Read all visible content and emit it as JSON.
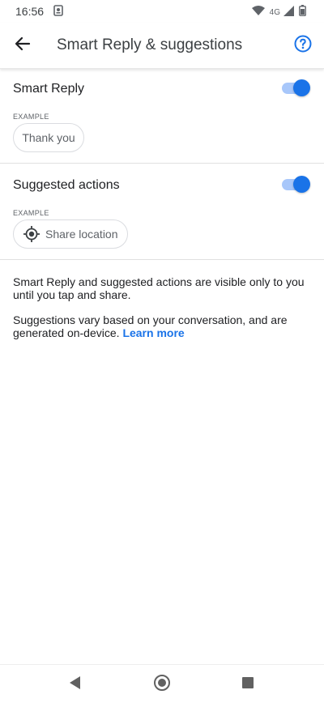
{
  "status_bar": {
    "time": "16:56",
    "network_label": "4G",
    "icons": [
      "app-notification-icon",
      "wifi-icon",
      "cellular-signal-icon",
      "battery-icon"
    ]
  },
  "header": {
    "title": "Smart Reply & suggestions",
    "back_icon": "arrow-back-icon",
    "help_icon": "help-circle-icon"
  },
  "smart_reply": {
    "title": "Smart Reply",
    "enabled": true,
    "example_label": "EXAMPLE",
    "example_chip": "Thank you"
  },
  "suggested_actions": {
    "title": "Suggested actions",
    "enabled": true,
    "example_label": "EXAMPLE",
    "example_chip": "Share location",
    "chip_icon": "location-target-icon"
  },
  "info": {
    "visibility_text": "Smart Reply and suggested actions are visible only to you until you tap and share.",
    "suggestions_text": "Suggestions vary based on your conversation, and are generated on-device.",
    "learn_more": "Learn more"
  },
  "nav": {
    "icons": [
      "back-triangle-icon",
      "home-circle-icon",
      "recents-square-icon"
    ]
  },
  "colors": {
    "accent": "#1a73e8",
    "toggle_track": "#a8c7fa",
    "divider": "#e0e0e0"
  }
}
